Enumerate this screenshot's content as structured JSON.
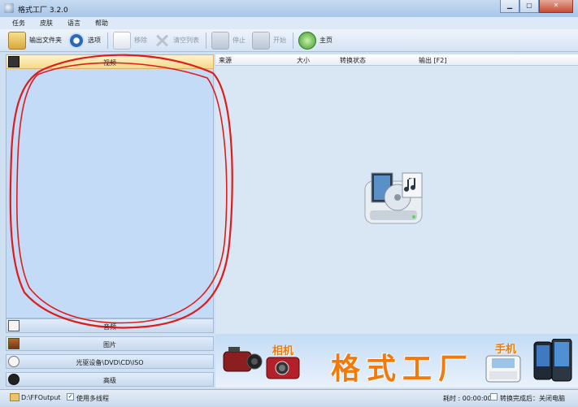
{
  "window": {
    "title": "格式工厂 3.2.0"
  },
  "menu": [
    "任务",
    "皮肤",
    "语言",
    "帮助"
  ],
  "toolbar": {
    "output_folder": "输出文件夹",
    "options": "选项",
    "remove": "移除",
    "clear_list": "清空列表",
    "stop": "停止",
    "start": "开始",
    "home": "主页"
  },
  "sidebar": {
    "video": "视频",
    "audio": "音频",
    "picture": "图片",
    "disc": "光驱设备\\DVD\\CD\\ISO",
    "advanced": "高级"
  },
  "table": {
    "columns": [
      "来源",
      "大小",
      "转换状态",
      "输出 [F2]"
    ]
  },
  "banner": {
    "camera": "相机",
    "brand": "格式工厂",
    "phone": "手机"
  },
  "status": {
    "output_path": "D:\\FFOutput",
    "multithread": "使用多线程",
    "elapsed": "耗时 : 00:00:00",
    "after_convert": "转换完成后：关闭电脑"
  },
  "colors": {
    "accent_orange": "#f07a0c",
    "annotation_red": "#e01b1b"
  }
}
